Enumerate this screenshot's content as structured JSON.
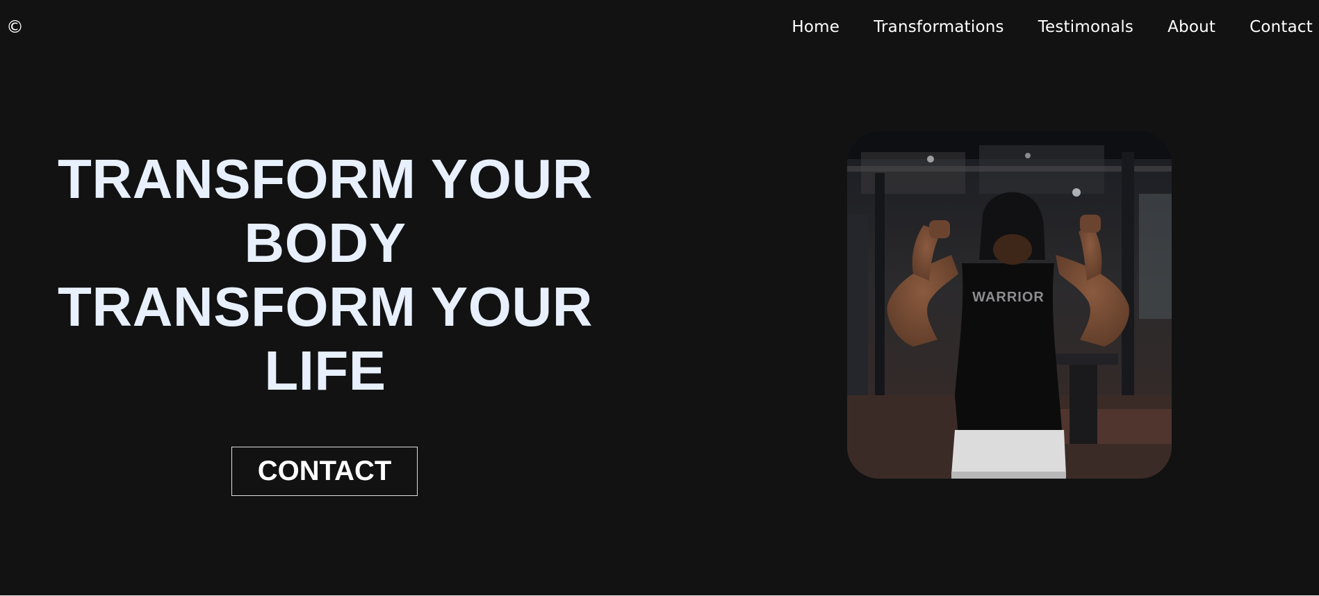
{
  "header": {
    "logo": "©",
    "nav": [
      {
        "label": "Home"
      },
      {
        "label": "Transformations"
      },
      {
        "label": "Testimonals"
      },
      {
        "label": "About"
      },
      {
        "label": "Contact"
      }
    ]
  },
  "hero": {
    "title_lines": [
      "TRANSFORM YOUR",
      "BODY",
      "TRANSFORM YOUR",
      "LIFE"
    ],
    "cta_label": "CONTACT",
    "photo": {
      "subject": "man flexing biceps in gym wearing black hoodie tank",
      "shirt_text": "WARRIOR"
    }
  },
  "colors": {
    "background": "#121212",
    "headline": "#e8f0fd",
    "text": "#ffffff",
    "button_border": "#e0e0e0"
  }
}
